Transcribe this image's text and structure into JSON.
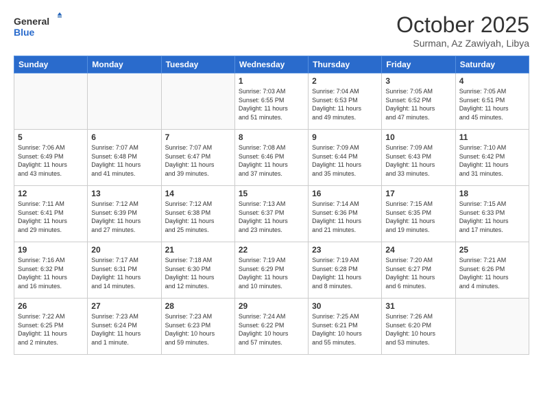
{
  "logo": {
    "general": "General",
    "blue": "Blue"
  },
  "title": "October 2025",
  "subtitle": "Surman, Az Zawiyah, Libya",
  "weekdays": [
    "Sunday",
    "Monday",
    "Tuesday",
    "Wednesday",
    "Thursday",
    "Friday",
    "Saturday"
  ],
  "weeks": [
    [
      {
        "day": "",
        "info": ""
      },
      {
        "day": "",
        "info": ""
      },
      {
        "day": "",
        "info": ""
      },
      {
        "day": "1",
        "info": "Sunrise: 7:03 AM\nSunset: 6:55 PM\nDaylight: 11 hours\nand 51 minutes."
      },
      {
        "day": "2",
        "info": "Sunrise: 7:04 AM\nSunset: 6:53 PM\nDaylight: 11 hours\nand 49 minutes."
      },
      {
        "day": "3",
        "info": "Sunrise: 7:05 AM\nSunset: 6:52 PM\nDaylight: 11 hours\nand 47 minutes."
      },
      {
        "day": "4",
        "info": "Sunrise: 7:05 AM\nSunset: 6:51 PM\nDaylight: 11 hours\nand 45 minutes."
      }
    ],
    [
      {
        "day": "5",
        "info": "Sunrise: 7:06 AM\nSunset: 6:49 PM\nDaylight: 11 hours\nand 43 minutes."
      },
      {
        "day": "6",
        "info": "Sunrise: 7:07 AM\nSunset: 6:48 PM\nDaylight: 11 hours\nand 41 minutes."
      },
      {
        "day": "7",
        "info": "Sunrise: 7:07 AM\nSunset: 6:47 PM\nDaylight: 11 hours\nand 39 minutes."
      },
      {
        "day": "8",
        "info": "Sunrise: 7:08 AM\nSunset: 6:46 PM\nDaylight: 11 hours\nand 37 minutes."
      },
      {
        "day": "9",
        "info": "Sunrise: 7:09 AM\nSunset: 6:44 PM\nDaylight: 11 hours\nand 35 minutes."
      },
      {
        "day": "10",
        "info": "Sunrise: 7:09 AM\nSunset: 6:43 PM\nDaylight: 11 hours\nand 33 minutes."
      },
      {
        "day": "11",
        "info": "Sunrise: 7:10 AM\nSunset: 6:42 PM\nDaylight: 11 hours\nand 31 minutes."
      }
    ],
    [
      {
        "day": "12",
        "info": "Sunrise: 7:11 AM\nSunset: 6:41 PM\nDaylight: 11 hours\nand 29 minutes."
      },
      {
        "day": "13",
        "info": "Sunrise: 7:12 AM\nSunset: 6:39 PM\nDaylight: 11 hours\nand 27 minutes."
      },
      {
        "day": "14",
        "info": "Sunrise: 7:12 AM\nSunset: 6:38 PM\nDaylight: 11 hours\nand 25 minutes."
      },
      {
        "day": "15",
        "info": "Sunrise: 7:13 AM\nSunset: 6:37 PM\nDaylight: 11 hours\nand 23 minutes."
      },
      {
        "day": "16",
        "info": "Sunrise: 7:14 AM\nSunset: 6:36 PM\nDaylight: 11 hours\nand 21 minutes."
      },
      {
        "day": "17",
        "info": "Sunrise: 7:15 AM\nSunset: 6:35 PM\nDaylight: 11 hours\nand 19 minutes."
      },
      {
        "day": "18",
        "info": "Sunrise: 7:15 AM\nSunset: 6:33 PM\nDaylight: 11 hours\nand 17 minutes."
      }
    ],
    [
      {
        "day": "19",
        "info": "Sunrise: 7:16 AM\nSunset: 6:32 PM\nDaylight: 11 hours\nand 16 minutes."
      },
      {
        "day": "20",
        "info": "Sunrise: 7:17 AM\nSunset: 6:31 PM\nDaylight: 11 hours\nand 14 minutes."
      },
      {
        "day": "21",
        "info": "Sunrise: 7:18 AM\nSunset: 6:30 PM\nDaylight: 11 hours\nand 12 minutes."
      },
      {
        "day": "22",
        "info": "Sunrise: 7:19 AM\nSunset: 6:29 PM\nDaylight: 11 hours\nand 10 minutes."
      },
      {
        "day": "23",
        "info": "Sunrise: 7:19 AM\nSunset: 6:28 PM\nDaylight: 11 hours\nand 8 minutes."
      },
      {
        "day": "24",
        "info": "Sunrise: 7:20 AM\nSunset: 6:27 PM\nDaylight: 11 hours\nand 6 minutes."
      },
      {
        "day": "25",
        "info": "Sunrise: 7:21 AM\nSunset: 6:26 PM\nDaylight: 11 hours\nand 4 minutes."
      }
    ],
    [
      {
        "day": "26",
        "info": "Sunrise: 7:22 AM\nSunset: 6:25 PM\nDaylight: 11 hours\nand 2 minutes."
      },
      {
        "day": "27",
        "info": "Sunrise: 7:23 AM\nSunset: 6:24 PM\nDaylight: 11 hours\nand 1 minute."
      },
      {
        "day": "28",
        "info": "Sunrise: 7:23 AM\nSunset: 6:23 PM\nDaylight: 10 hours\nand 59 minutes."
      },
      {
        "day": "29",
        "info": "Sunrise: 7:24 AM\nSunset: 6:22 PM\nDaylight: 10 hours\nand 57 minutes."
      },
      {
        "day": "30",
        "info": "Sunrise: 7:25 AM\nSunset: 6:21 PM\nDaylight: 10 hours\nand 55 minutes."
      },
      {
        "day": "31",
        "info": "Sunrise: 7:26 AM\nSunset: 6:20 PM\nDaylight: 10 hours\nand 53 minutes."
      },
      {
        "day": "",
        "info": ""
      }
    ]
  ]
}
